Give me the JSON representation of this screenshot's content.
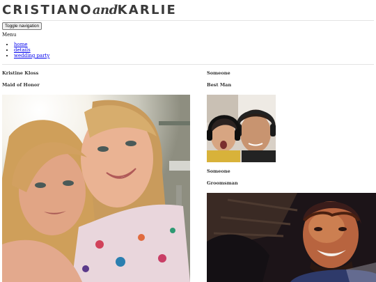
{
  "brand": {
    "first": "CRISTIANO",
    "and": "and",
    "second": "KARLIE"
  },
  "nav": {
    "toggle_label": "Toggle navigation",
    "menu_label": "Menu",
    "items": [
      {
        "label": "home"
      },
      {
        "label": "details"
      },
      {
        "label": "wedding party"
      }
    ]
  },
  "party": [
    {
      "name": "Kristine Kloss",
      "role": "Maid of Honor",
      "photo": "selfie-two-women"
    },
    {
      "name": "Someone",
      "role": "Best Man",
      "photo": "boy-and-man-with-headphones"
    },
    {
      "name": "Someone",
      "role": "Groomsman",
      "photo": "smiling-man-night-selfie"
    }
  ]
}
